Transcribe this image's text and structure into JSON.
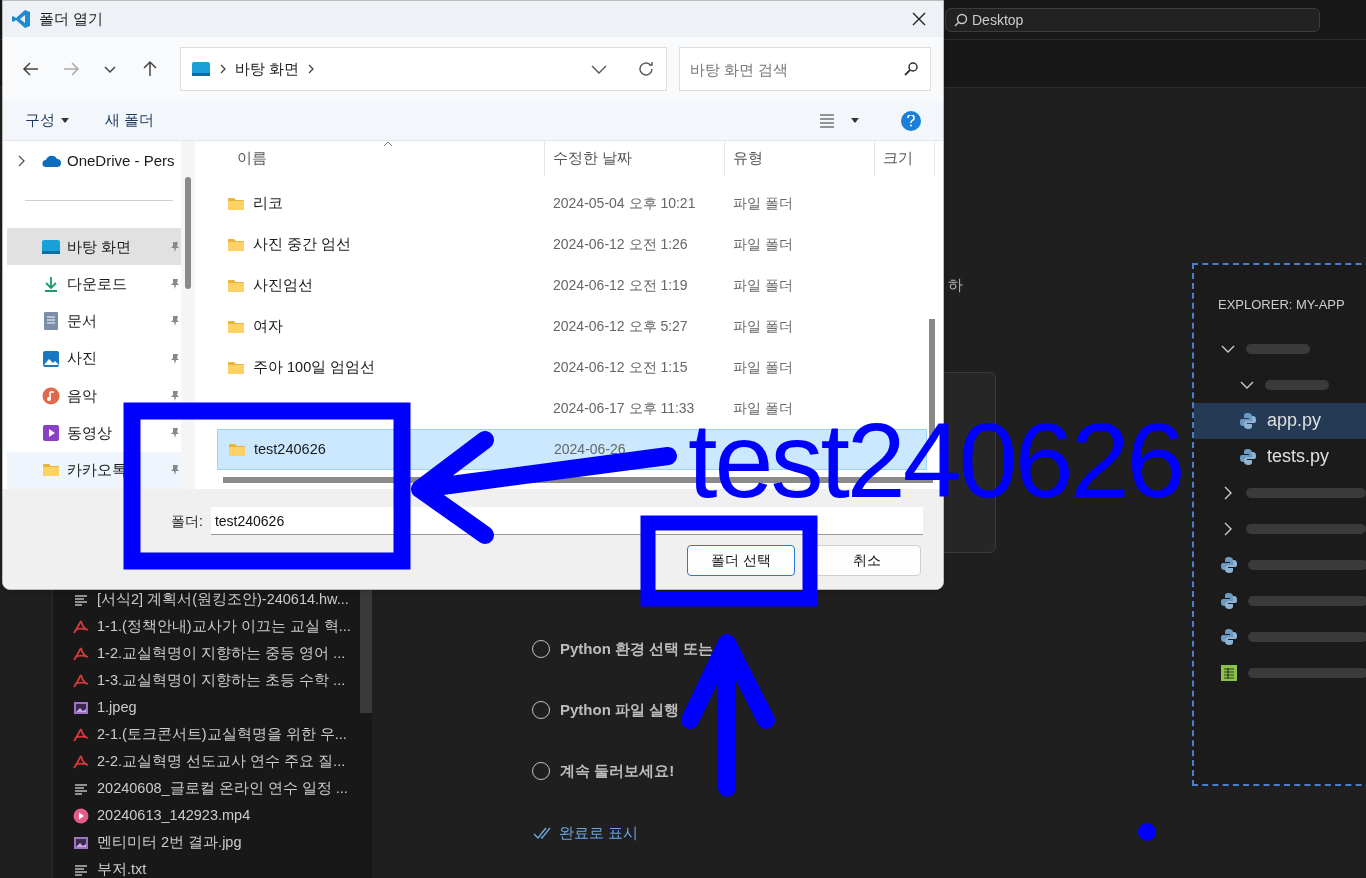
{
  "titlebar_search": "Desktop",
  "dialog": {
    "title": "폴더 열기",
    "breadcrumb": [
      "바탕 화면"
    ],
    "search_placeholder": "바탕 화면 검색",
    "commands": [
      "구성",
      "새 폴더"
    ],
    "sidebar": [
      {
        "label": "OneDrive - Pers",
        "kind": "cloud",
        "selected": false
      },
      {
        "label": "바탕 화면",
        "kind": "desktop",
        "selected": true
      },
      {
        "label": "다운로드",
        "kind": "download",
        "selected": false
      },
      {
        "label": "문서",
        "kind": "document",
        "selected": false
      },
      {
        "label": "사진",
        "kind": "pictures",
        "selected": false
      },
      {
        "label": "음악",
        "kind": "music",
        "selected": false
      },
      {
        "label": "동영상",
        "kind": "video",
        "selected": false
      },
      {
        "label": "카카오톡",
        "kind": "folder",
        "selected": false
      }
    ],
    "columns": [
      "이름",
      "수정한 날짜",
      "유형",
      "크기"
    ],
    "rows": [
      {
        "name": "리코",
        "modified": "2024-05-04 오후 10:21",
        "type": "파일 폴더",
        "selected": false
      },
      {
        "name": "사진 중간 엄선",
        "modified": "2024-06-12 오전 1:26",
        "type": "파일 폴더",
        "selected": false
      },
      {
        "name": "사진엄선",
        "modified": "2024-06-12 오전 1:19",
        "type": "파일 폴더",
        "selected": false
      },
      {
        "name": "여자",
        "modified": "2024-06-12 오후 5:27",
        "type": "파일 폴더",
        "selected": false
      },
      {
        "name": "주아 100일 엄엄선",
        "modified": "2024-06-12 오전 1:15",
        "type": "파일 폴더",
        "selected": false
      },
      {
        "modified": "2024-06-17 오후 11:33",
        "type": "파일 폴더",
        "selected": false
      },
      {
        "name": "test240626",
        "modified": "2024-06-26",
        "selected": true
      }
    ],
    "folder_label": "폴더:",
    "folder_value": "test240626",
    "buttons": [
      {
        "label": "폴더 선택",
        "kind": "primary"
      },
      {
        "label": "취소",
        "kind": "secondary"
      }
    ]
  },
  "vscode_files": [
    {
      "name": "[서식2] 계획서(원킹조안)-240614.hw...",
      "kind": "text"
    },
    {
      "name": "1-1.(정책안내)교사가 이끄는 교실 혁...",
      "kind": "pdf"
    },
    {
      "name": "1-2.교실혁명이 지향하는 중등 영어 ...",
      "kind": "pdf"
    },
    {
      "name": "1-3.교실혁명이 지향하는 초등 수학 ...",
      "kind": "pdf"
    },
    {
      "name": "1.jpeg",
      "kind": "image"
    },
    {
      "name": "2-1.(토크콘서트)교실혁명을 위한 우...",
      "kind": "pdf"
    },
    {
      "name": "2-2.교실혁명 선도교사 연수 주요 질...",
      "kind": "pdf"
    },
    {
      "name": "20240608_글로컬 온라인 연수 일정 ...",
      "kind": "text"
    },
    {
      "name": "20240613_142923.mp4",
      "kind": "video"
    },
    {
      "name": "멘티미터 2번 결과.jpg",
      "kind": "image"
    },
    {
      "name": "부저.txt",
      "kind": "text"
    }
  ],
  "walkthrough": {
    "partial_text": "하",
    "steps": [
      {
        "title": "Python 환경 선택 또는",
        "checked": false
      },
      {
        "title": "Python 파일 실행",
        "checked": false
      },
      {
        "title": "계속 둘러보세요!",
        "checked": false
      }
    ],
    "mark_done": "완료로 표시"
  },
  "explorer_preview": {
    "title": "EXPLORER: MY-APP",
    "items": [
      {
        "kind": "folder",
        "expanded": true,
        "children": [
          {
            "kind": "folder",
            "expanded": true
          },
          {
            "kind": "python",
            "name": "app.py",
            "selected": true
          },
          {
            "kind": "python",
            "name": "tests.py",
            "selected": false
          }
        ]
      },
      {
        "kind": "folder",
        "expanded": false
      },
      {
        "kind": "folder",
        "expanded": false
      },
      {
        "kind": "python"
      },
      {
        "kind": "python"
      },
      {
        "kind": "python"
      },
      {
        "kind": "sheet"
      }
    ]
  },
  "annotation": {
    "text": "test240626"
  }
}
